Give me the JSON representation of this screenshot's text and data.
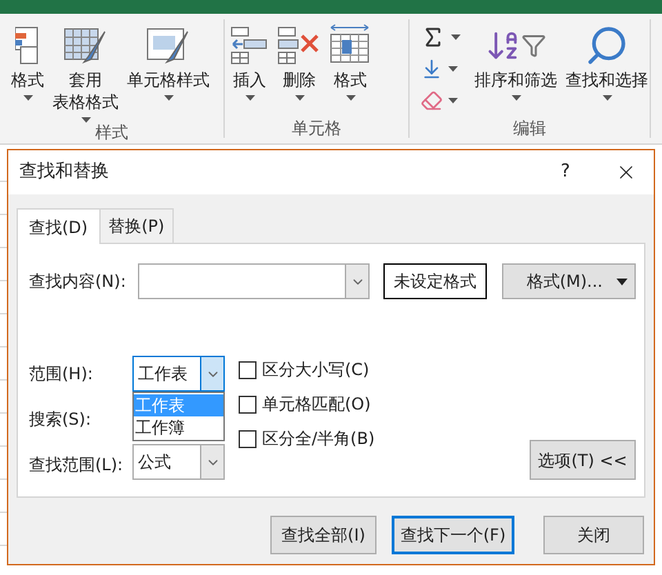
{
  "ribbon": {
    "groups": [
      {
        "label": "样式",
        "buttons": [
          {
            "kind": "cond-format",
            "lines": [
              "格式"
            ]
          },
          {
            "kind": "table-style",
            "lines": [
              "套用",
              "表格格式"
            ]
          },
          {
            "kind": "cell-style",
            "lines": [
              "单元格样式"
            ]
          }
        ]
      },
      {
        "label": "单元格",
        "buttons": [
          {
            "kind": "insert",
            "lines": [
              "插入"
            ]
          },
          {
            "kind": "delete",
            "lines": [
              "删除"
            ]
          },
          {
            "kind": "format",
            "lines": [
              "格式"
            ]
          }
        ]
      },
      {
        "label": "编辑",
        "tools": [
          {
            "kind": "sum"
          },
          {
            "kind": "fill"
          },
          {
            "kind": "clear"
          }
        ],
        "buttons": [
          {
            "kind": "sort",
            "lines": [
              "排序和筛选"
            ]
          },
          {
            "kind": "find",
            "lines": [
              "查找和选择"
            ]
          }
        ]
      }
    ]
  },
  "dialog": {
    "title": "查找和替换",
    "help": "?",
    "tabs": [
      {
        "label": "查找(D)",
        "selected": true
      },
      {
        "label": "替换(P)",
        "selected": false
      }
    ],
    "find_what": {
      "label": "查找内容(N):"
    },
    "format_status": "未设定格式",
    "format_button": "格式(M)...",
    "scope": {
      "label": "范围(H):",
      "value": "工作表",
      "open": true,
      "options": [
        {
          "label": "工作表",
          "selected": true
        },
        {
          "label": "工作簿",
          "selected": false
        }
      ]
    },
    "search": {
      "label": "搜索(S):"
    },
    "look_in": {
      "label": "查找范围(L):",
      "value": "公式"
    },
    "checkboxes": [
      {
        "label": "区分大小写(C)",
        "checked": false
      },
      {
        "label": "单元格匹配(O)",
        "checked": false
      },
      {
        "label": "区分全/半角(B)",
        "checked": false
      }
    ],
    "options_button": "选项(T) <<",
    "buttons": [
      {
        "label": "查找全部(I)",
        "default": false
      },
      {
        "label": "查找下一个(F)",
        "default": true
      },
      {
        "label": "关闭",
        "default": false
      }
    ]
  }
}
